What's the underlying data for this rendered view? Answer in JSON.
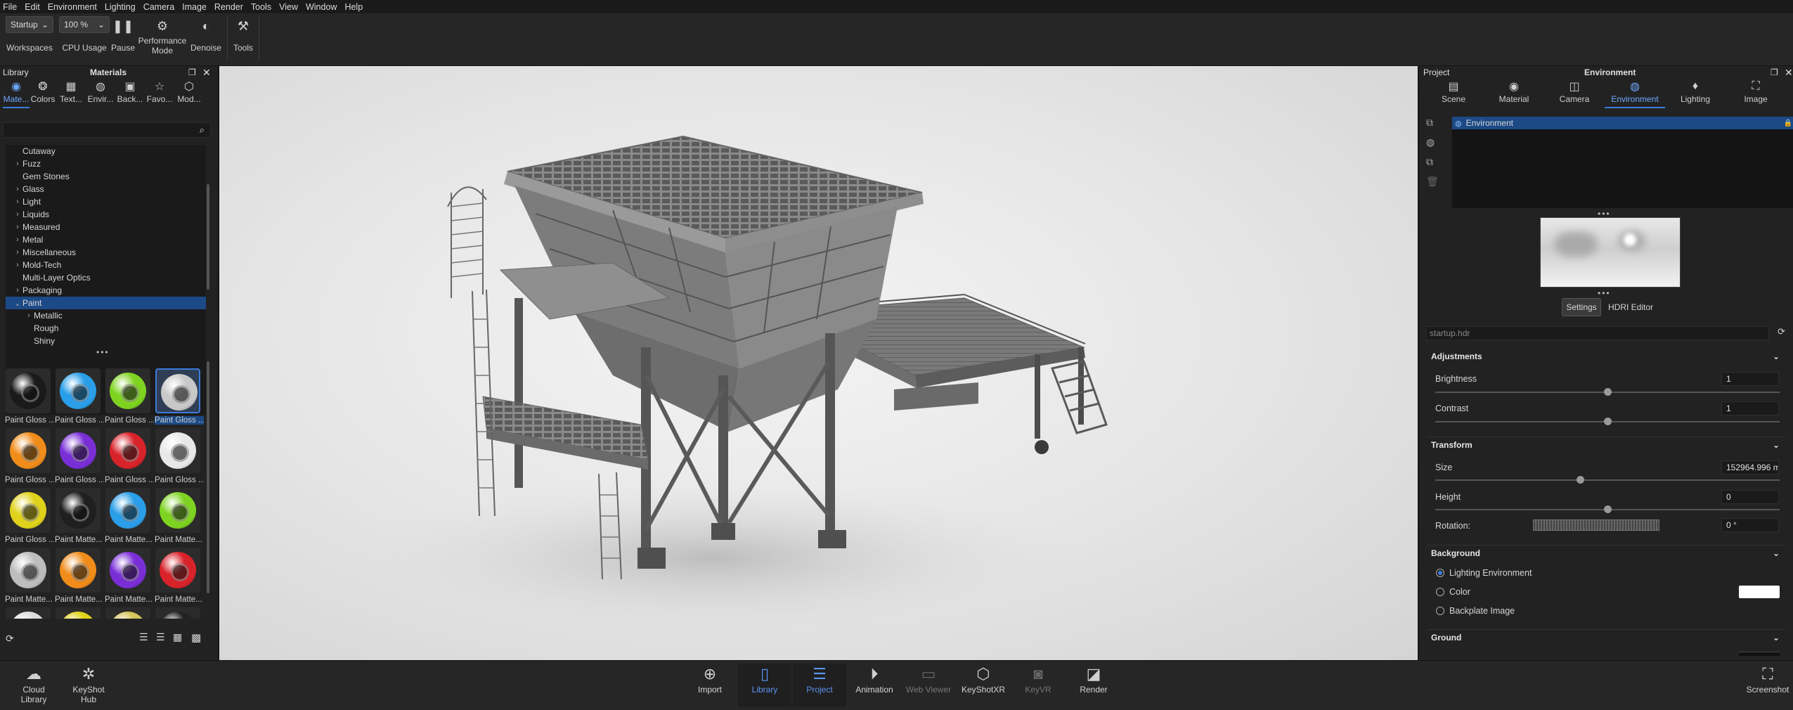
{
  "menu": [
    "File",
    "Edit",
    "Environment",
    "Lighting",
    "Camera",
    "Image",
    "Render",
    "Tools",
    "View",
    "Window",
    "Help"
  ],
  "toolbar": {
    "workspace_select": "Startup",
    "workspaces_label": "Workspaces",
    "cpu_select": "100 %",
    "cpu_label": "CPU Usage",
    "pause_label": "Pause",
    "performance_label": "Performance Mode",
    "denoise_label": "Denoise",
    "tools_label": "Tools"
  },
  "library": {
    "title": "Library",
    "subtitle": "Materials",
    "tabs": [
      "Mate...",
      "Colors",
      "Text...",
      "Envir...",
      "Back...",
      "Favo...",
      "Mod..."
    ],
    "tree": [
      {
        "label": "Cutaway",
        "arrow": "",
        "indent": 0,
        "selected": false
      },
      {
        "label": "Fuzz",
        "arrow": "›",
        "indent": 0,
        "selected": false
      },
      {
        "label": "Gem Stones",
        "arrow": "",
        "indent": 0,
        "selected": false
      },
      {
        "label": "Glass",
        "arrow": "›",
        "indent": 0,
        "selected": false
      },
      {
        "label": "Light",
        "arrow": "›",
        "indent": 0,
        "selected": false
      },
      {
        "label": "Liquids",
        "arrow": "›",
        "indent": 0,
        "selected": false
      },
      {
        "label": "Measured",
        "arrow": "›",
        "indent": 0,
        "selected": false
      },
      {
        "label": "Metal",
        "arrow": "›",
        "indent": 0,
        "selected": false
      },
      {
        "label": "Miscellaneous",
        "arrow": "›",
        "indent": 0,
        "selected": false
      },
      {
        "label": "Mold-Tech",
        "arrow": "›",
        "indent": 0,
        "selected": false
      },
      {
        "label": "Multi-Layer Optics",
        "arrow": "",
        "indent": 0,
        "selected": false
      },
      {
        "label": "Packaging",
        "arrow": "›",
        "indent": 0,
        "selected": false
      },
      {
        "label": "Paint",
        "arrow": "⌄",
        "indent": 0,
        "selected": true
      },
      {
        "label": "Metallic",
        "arrow": "›",
        "indent": 1,
        "selected": false
      },
      {
        "label": "Rough",
        "arrow": "",
        "indent": 1,
        "selected": false
      },
      {
        "label": "Shiny",
        "arrow": "",
        "indent": 1,
        "selected": false
      }
    ],
    "thumbs": [
      {
        "caption": "Paint Gloss ...",
        "color": "#1a1a1a"
      },
      {
        "caption": "Paint Gloss ...",
        "color": "#2a9ee8"
      },
      {
        "caption": "Paint Gloss ...",
        "color": "#7ed321"
      },
      {
        "caption": "Paint Gloss ...",
        "color": "#c8c8c8"
      },
      {
        "caption": "Paint Gloss ...",
        "color": "#f08c1a"
      },
      {
        "caption": "Paint Gloss ...",
        "color": "#7a2fd6"
      },
      {
        "caption": "Paint Gloss ...",
        "color": "#d8232a"
      },
      {
        "caption": "Paint Gloss ...",
        "color": "#e8e8e8"
      },
      {
        "caption": "Paint Gloss ...",
        "color": "#e0d21a"
      },
      {
        "caption": "Paint Matte...",
        "color": "#1f1f1f"
      },
      {
        "caption": "Paint Matte...",
        "color": "#2a9ee8"
      },
      {
        "caption": "Paint Matte...",
        "color": "#7ed321"
      },
      {
        "caption": "Paint Matte...",
        "color": "#bdbdbd"
      },
      {
        "caption": "Paint Matte...",
        "color": "#f08c1a"
      },
      {
        "caption": "Paint Matte...",
        "color": "#7a2fd6"
      },
      {
        "caption": "Paint Matte...",
        "color": "#d8232a"
      }
    ],
    "partial_thumbs": [
      "#dcdcdc",
      "#e0d21a",
      "#d4c45a",
      "#222222"
    ]
  },
  "project": {
    "title": "Project",
    "subtitle": "Environment",
    "tabs": [
      "Scene",
      "Material",
      "Camera",
      "Environment",
      "Lighting",
      "Image"
    ],
    "active_tab": "Environment",
    "env_list": [
      "Environment"
    ],
    "settings_tab": "Settings",
    "hdri_tab": "HDRI Editor",
    "hdr_file": "startup.hdr",
    "adjustments": {
      "title": "Adjustments",
      "brightness_label": "Brightness",
      "brightness": "1",
      "brightness_frac": 0.5,
      "contrast_label": "Contrast",
      "contrast": "1",
      "contrast_frac": 0.5
    },
    "transform": {
      "title": "Transform",
      "size_label": "Size",
      "size": "152964.996 m",
      "size_frac": 0.42,
      "height_label": "Height",
      "height": "0",
      "height_frac": 0.5,
      "rotation_label": "Rotation:",
      "rotation": "0 °"
    },
    "background": {
      "title": "Background",
      "options": [
        "Lighting Environment",
        "Color",
        "Backplate Image"
      ],
      "selected": 0,
      "color": "#ffffff"
    },
    "ground": {
      "title": "Ground"
    }
  },
  "bottombar": {
    "left": [
      "Cloud Library",
      "KeyShot Hub"
    ],
    "center": [
      {
        "label": "Import",
        "state": "normal"
      },
      {
        "label": "Library",
        "state": "active"
      },
      {
        "label": "Project",
        "state": "active"
      },
      {
        "label": "Animation",
        "state": "normal"
      },
      {
        "label": "Web Viewer",
        "state": "dim"
      },
      {
        "label": "KeyShotXR",
        "state": "normal"
      },
      {
        "label": "KeyVR",
        "state": "dim"
      },
      {
        "label": "Render",
        "state": "normal"
      }
    ],
    "right": "Screenshot"
  }
}
